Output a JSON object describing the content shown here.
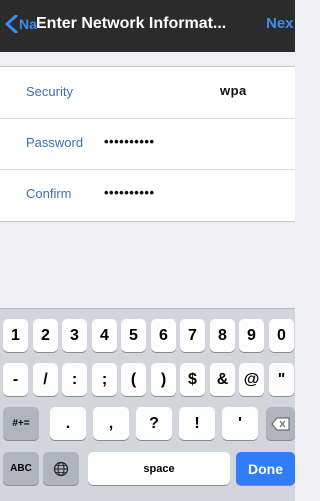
{
  "navbar": {
    "back_label": "Na",
    "title": "Enter Network Informat...",
    "next_label": "Nex"
  },
  "form": {
    "rows": [
      {
        "label": "Security",
        "value": "wpa"
      },
      {
        "label": "Password",
        "value": "••••••••••"
      },
      {
        "label": "Confirm",
        "value": "••••••••••"
      }
    ]
  },
  "keyboard": {
    "row1": [
      "1",
      "2",
      "3",
      "4",
      "5",
      "6",
      "7",
      "8",
      "9",
      "0"
    ],
    "row2": [
      "-",
      "/",
      ":",
      ";",
      "(",
      ")",
      "$",
      "&",
      "@",
      "\""
    ],
    "row3": [
      "#+=",
      ".",
      ",",
      "?",
      "!",
      "'"
    ],
    "row4": {
      "abc": "ABC",
      "space": "space",
      "done": "Done"
    }
  },
  "colors": {
    "accent": "#3b8cf0",
    "nav_bg": "#2b2b2b",
    "label": "#3b6fb5",
    "done_bg": "#2f7df7"
  },
  "icons": {
    "back": "chevron-left-icon",
    "globe": "globe-icon",
    "delete": "backspace-icon"
  }
}
